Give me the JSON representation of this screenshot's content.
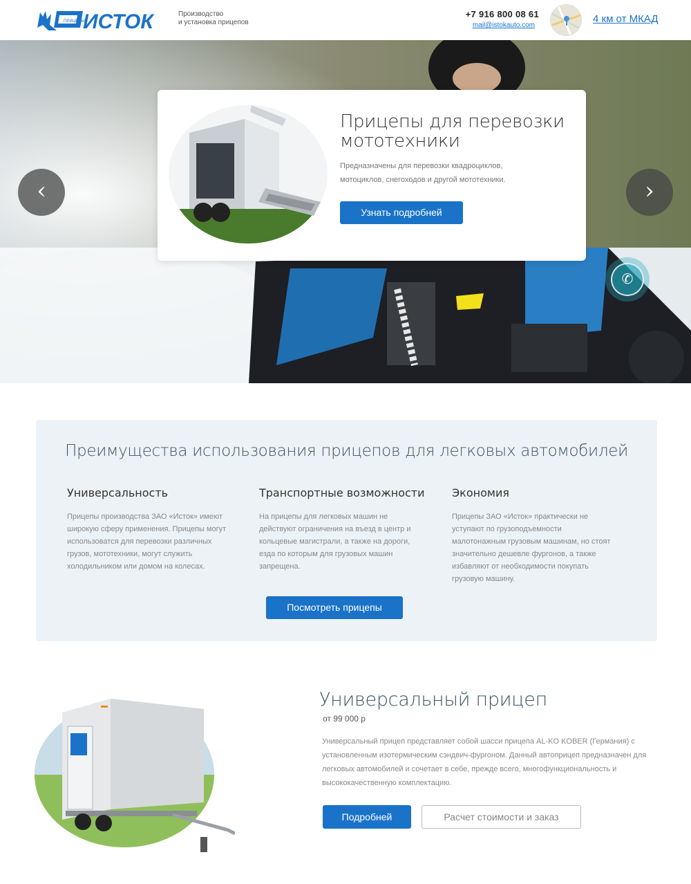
{
  "header": {
    "logo_text": "ИСТОК",
    "logo_sub": "ПРИЦЕПЫ",
    "tagline_line1": "Производство",
    "tagline_line2": "и установка прицепов",
    "phone": "+7 916 800 08 61",
    "email": "mail@istokauto.com",
    "location_link": "4 км от МКАД"
  },
  "slider": {
    "title": "Прицепы для перевозки мототехники",
    "description": "Предназначены для перевозки квадроциклов, мотоциклов, снегоходов и другой мототехники.",
    "button_label": "Узнать подробней",
    "prev_label": "‹",
    "next_label": "›"
  },
  "advantages": {
    "title": "Преимущества использования прицепов для легковых автомобилей",
    "items": [
      {
        "heading": "Универсальность",
        "text": "Прицепы производства ЗАО «Исток» имеют широкую сферу применения. Прицепы могут использоватся для перевозки различных грузов, мототехники, могут служить холодильником или домом на колесах."
      },
      {
        "heading": "Транспортные возможности",
        "text": "На прицепы для легковых машин не действуют ограничения на въезд в центр и кольцевые магистрали, а также на дороги, езда по которым для грузовых машин запрещена."
      },
      {
        "heading": "Экономия",
        "text": "Прицепы ЗАО «Исток» практически не уступают по грузоподъемности малотонажным грузовым машинам, но стоят значительно дешевле фургонов, а также избавляют от необходимости покупать грузовую машину."
      }
    ],
    "button_label": "Посмотреть прицепы"
  },
  "product": {
    "title": "Универсальный прицеп",
    "price": "от 99 000 р",
    "description": "Универсальный прицеп представляет собой шасси прицепа AL-KO KOBER (Германия) с установленным изотермическим сэндвич-фургоном. Данный автоприцеп предназначен для легковых автомобилей и сочетает в себе, прежде всего, многофункциональность и высококачественную комплектацию.",
    "details_button": "Подробней",
    "order_button": "Расчет стоимости и заказ"
  },
  "colors": {
    "accent": "#1a73c8",
    "panel_bg": "#edf2f6",
    "heading": "#3a5366"
  },
  "icons": {
    "call": "phone-call-icon",
    "prev": "chevron-left-icon",
    "next": "chevron-right-icon"
  }
}
